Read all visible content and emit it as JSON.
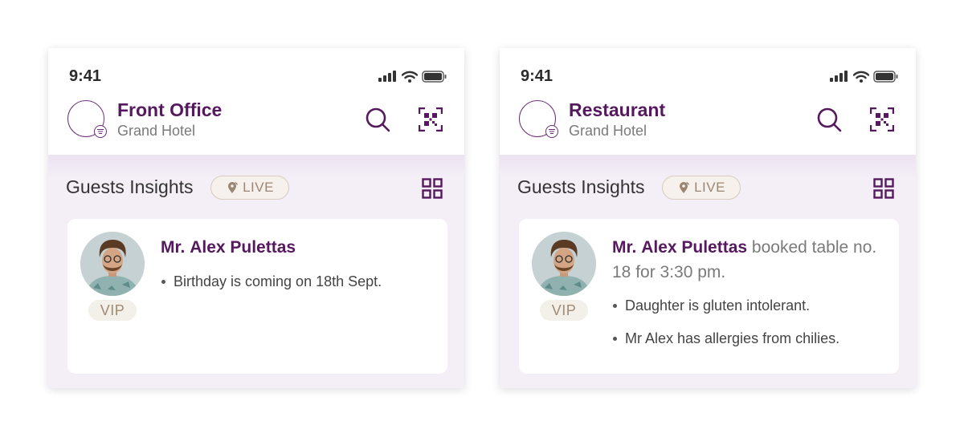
{
  "colors": {
    "brand_purple": "#56185f",
    "accent_purple": "#6b2d7a",
    "live_text": "#9a8672",
    "panel_background": "#f4eff7"
  },
  "screens": [
    {
      "status_bar": {
        "time": "9:41"
      },
      "header": {
        "department": "Front Office",
        "hotel": "Grand Hotel",
        "search_icon": "search-icon",
        "scan_icon": "qr-scan-icon"
      },
      "section": {
        "title": "Guests Insights",
        "live_label": "LIVE",
        "layout_icon": "grid-view-icon"
      },
      "card": {
        "title_prefix": "Mr.",
        "guest_name": "Alex Pulettas",
        "title_suffix": "",
        "badge": "VIP",
        "notes": [
          "Birthday is coming on 18th Sept."
        ]
      }
    },
    {
      "status_bar": {
        "time": "9:41"
      },
      "header": {
        "department": "Restaurant",
        "hotel": "Grand Hotel",
        "search_icon": "search-icon",
        "scan_icon": "qr-scan-icon"
      },
      "section": {
        "title": "Guests Insights",
        "live_label": "LIVE",
        "layout_icon": "grid-view-icon"
      },
      "card": {
        "title_prefix": "Mr.",
        "guest_name": "Alex Pulettas",
        "title_suffix": " booked table no. 18 for 3:30 pm.",
        "badge": "VIP",
        "notes": [
          "Daughter is gluten intolerant.",
          "Mr Alex has allergies from chilies."
        ]
      }
    }
  ]
}
